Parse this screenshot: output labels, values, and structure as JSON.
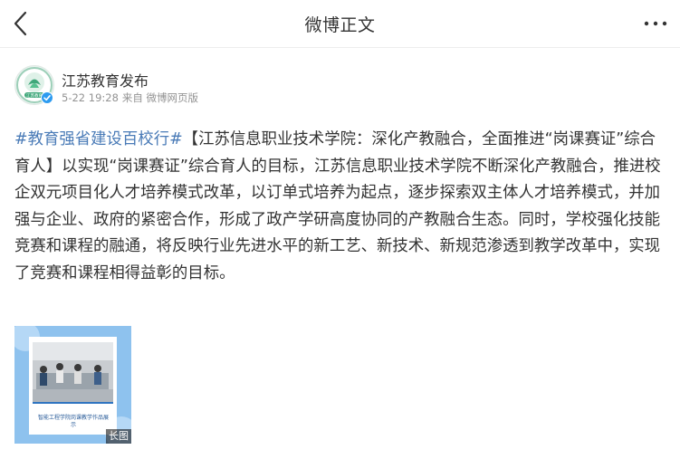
{
  "header": {
    "title": "微博正文"
  },
  "author": {
    "name": "江苏教育发布",
    "date": "5-22 19:28",
    "source": "来自 微博网页版",
    "avatar_text": "江苏教育"
  },
  "post": {
    "hashtag": "#教育强省建设百校行#",
    "body": "【江苏信息职业技术学院：深化产教融合，全面推进“岗课赛证”综合育人】以实现“岗课赛证”综合育人的目标，江苏信息职业技术学院不断深化产教融合，推进校企双元项目化人才培养模式改革，以订单式培养为起点，逐步探索双主体人才培养模式，并加强与企业、政府的紧密合作，形成了政产学研高度协同的产教融合生态。同时，学校强化技能竞赛和课程的融通，将反映行业先进水平的新工艺、新技术、新规范渗透到教学改革中，实现了竞赛和课程相得益彰的目标。"
  },
  "image": {
    "caption": "智能工程学院岗课教学作品展示",
    "badge": "长图"
  },
  "colors": {
    "hashtag": "#4a7bb7",
    "text": "#333333",
    "meta": "#939393"
  },
  "icons": {
    "back": "chevron-left-icon",
    "more": "more-dots-icon",
    "verified": "verified-badge-icon"
  }
}
